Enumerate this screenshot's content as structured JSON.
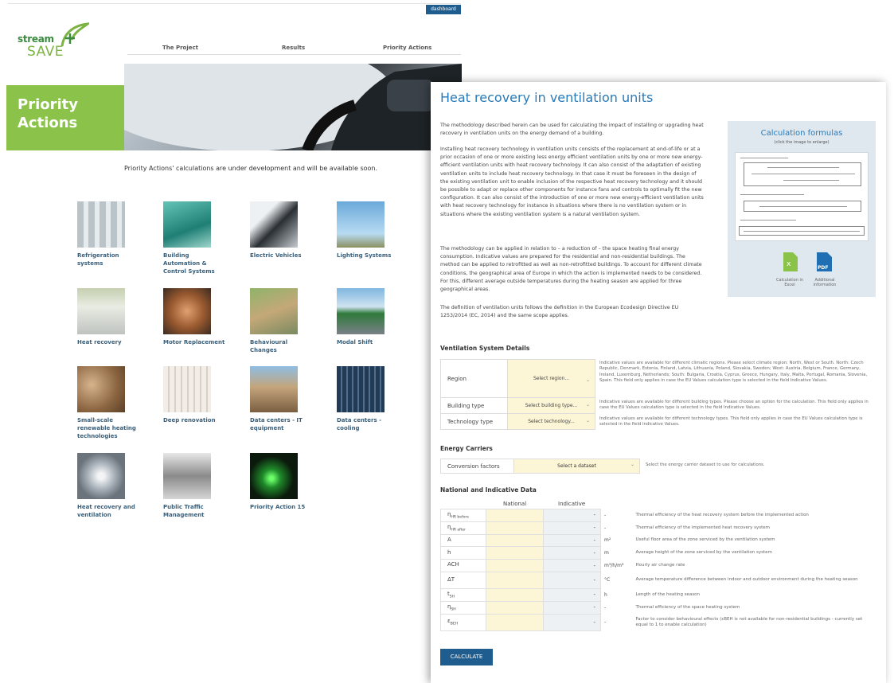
{
  "header": {
    "dashboard_label": "dashboard",
    "logo_top": "stream",
    "logo_bottom": "SAVE"
  },
  "nav": [
    {
      "label": "The Project"
    },
    {
      "label": "Results"
    },
    {
      "label": "Priority Actions"
    }
  ],
  "hero_title": "Priority Actions",
  "notice": "Priority Actions' calculations are under development and will be available soon.",
  "tiles": [
    {
      "label": "Refrigeration systems",
      "icon": "refrigeration-image"
    },
    {
      "label": "Building Automation & Control Systems",
      "icon": "building-automation-image"
    },
    {
      "label": "Electric Vehicles",
      "icon": "electric-vehicle-image"
    },
    {
      "label": "Lighting Systems",
      "icon": "lighting-image"
    },
    {
      "label": "Heat recovery",
      "icon": "heat-recovery-image"
    },
    {
      "label": "Motor Replacement",
      "icon": "motor-image"
    },
    {
      "label": "Behavioural Changes",
      "icon": "behaviour-image"
    },
    {
      "label": "Modal Shift",
      "icon": "modal-shift-image"
    },
    {
      "label": "Small-scale renewable heating technologies",
      "icon": "renewable-heating-image"
    },
    {
      "label": "Deep renovation",
      "icon": "renovation-image"
    },
    {
      "label": "Data centers - IT equipment",
      "icon": "datacenter-it-image"
    },
    {
      "label": "Data centers - cooling",
      "icon": "datacenter-cooling-image"
    },
    {
      "label": "Heat recovery and ventilation",
      "icon": "ventilation-fan-image"
    },
    {
      "label": "Public Traffic Management",
      "icon": "traffic-image"
    },
    {
      "label": "Priority Action 15",
      "icon": "traffic-light-image"
    }
  ],
  "panel": {
    "title": "Heat recovery in ventilation units",
    "paragraphs": [
      "The methodology described herein can be used for calculating the impact of installing or upgrading heat recovery in ventilation units on the energy demand of a building.",
      "Installing heat recovery technology in ventilation units consists of the replacement at end-of-life or at a prior occasion of one or more existing less energy efficient ventilation units by one or more new energy-efficient ventilation units with heat recovery technology. It can also consist of the adaptation of existing ventilation units to include heat recovery technology. In that case it must be foreseen in the design of the existing ventilation unit to enable inclusion of the respective heat recovery technology and it should be possible to adapt or replace other components for instance fans and controls to optimally fit the new configuration. It can also consist of the introduction of one or more new energy-efficient ventilation units with heat recovery technology for instance in situations where there is no ventilation system or in situations where the existing ventilation system is a natural ventilation system.",
      "The methodology can be applied in relation to – a reduction of – the space heating final energy consumption. Indicative values are prepared for the residential and non-residential buildings. The method can be applied to retrofitted as well as non-retrofitted buildings. To account for different climate conditions, the geographical area of Europe in which the action is implemented needs to be considered. For this, different average outside temperatures during the heating season are applied for three geographical areas.",
      "The definition of ventilation units follows the definition in the European Ecodesign Directive EU 1253/2014 (EC, 2014) and the same scope applies."
    ],
    "formulas": {
      "title": "Calculation formulas",
      "subtitle": "(click the image to enlarge)",
      "excel_label": "Calculation in Excel",
      "pdf_label": "Additional information",
      "pdf_badge": "PDF"
    },
    "ventilation": {
      "heading": "Ventilation System Details",
      "rows": [
        {
          "label": "Region",
          "select": "Select region...",
          "hint": "Indicative values are available for different climatic regions. Please select climate region: North, West or South. North: Czech Republic, Denmark, Estonia, Finland, Latvia, Lithuania, Poland, Slovakia, Sweden; West: Austria, Belgium, France, Germany, Ireland, Luxemburg, Netherlands; South: Bulgaria, Croatia, Cyprus, Greece, Hungary, Italy, Malta, Portugal, Romania, Slovenia, Spain. This field only applies in case the EU Values calculation type is selected in the field Indicative Values."
        },
        {
          "label": "Building type",
          "select": "Select building type...",
          "hint": "Indicative values are available for different building types. Please choose an option for the calculation. This field only applies in case the EU Values calculation type is selected in the field Indicative Values."
        },
        {
          "label": "Technology type",
          "select": "Select technology...",
          "hint": "Indicative values are available for different technology types. This field only applies in case the EU Values calculation type is selected in the field Indicative Values."
        }
      ]
    },
    "energy": {
      "heading": "Energy Carriers",
      "label": "Conversion factors",
      "select": "Select a dataset",
      "hint": "Select the energy carrier dataset to use for calculations."
    },
    "national": {
      "heading": "National and Indicative Data",
      "col_national": "National",
      "col_indicative": "Indicative",
      "rows": [
        {
          "sym": "η",
          "sub": "HR before",
          "ind": "-",
          "unit": "-",
          "desc": "Thermal efficiency of the heat recovery system before the implemented action"
        },
        {
          "sym": "η",
          "sub": "HR after",
          "ind": "-",
          "unit": "-",
          "desc": "Thermal efficiency of the implemented heat recovery system"
        },
        {
          "sym": "A",
          "sub": "",
          "ind": "-",
          "unit": "m²",
          "desc": "Useful floor area of the zone serviced by the ventilation system"
        },
        {
          "sym": "h",
          "sub": "",
          "ind": "-",
          "unit": "m",
          "desc": "Average height of the zone serviced by the ventilation system"
        },
        {
          "sym": "ACH",
          "sub": "",
          "ind": "-",
          "unit": "m³/h/m³",
          "desc": "Hourly air change rate"
        },
        {
          "sym": "ΔT",
          "sub": "",
          "ind": "-",
          "unit": "°C",
          "desc": "Average temperature difference between indoor and outdoor environment during the heating season"
        },
        {
          "sym": "t",
          "sub": "SH",
          "ind": "-",
          "unit": "h",
          "desc": "Length of the heating season"
        },
        {
          "sym": "η",
          "sub": "SH",
          "ind": "-",
          "unit": "-",
          "desc": "Thermal efficiency of the space heating system"
        },
        {
          "sym": "ε",
          "sub": "BEH",
          "ind": "-",
          "unit": "-",
          "desc": "Factor to consider behavioural effects (εBEH is not available for non-residential buildings - currently set equal to 1 to enable calculation)"
        }
      ]
    },
    "calculate_label": "CALCULATE"
  }
}
